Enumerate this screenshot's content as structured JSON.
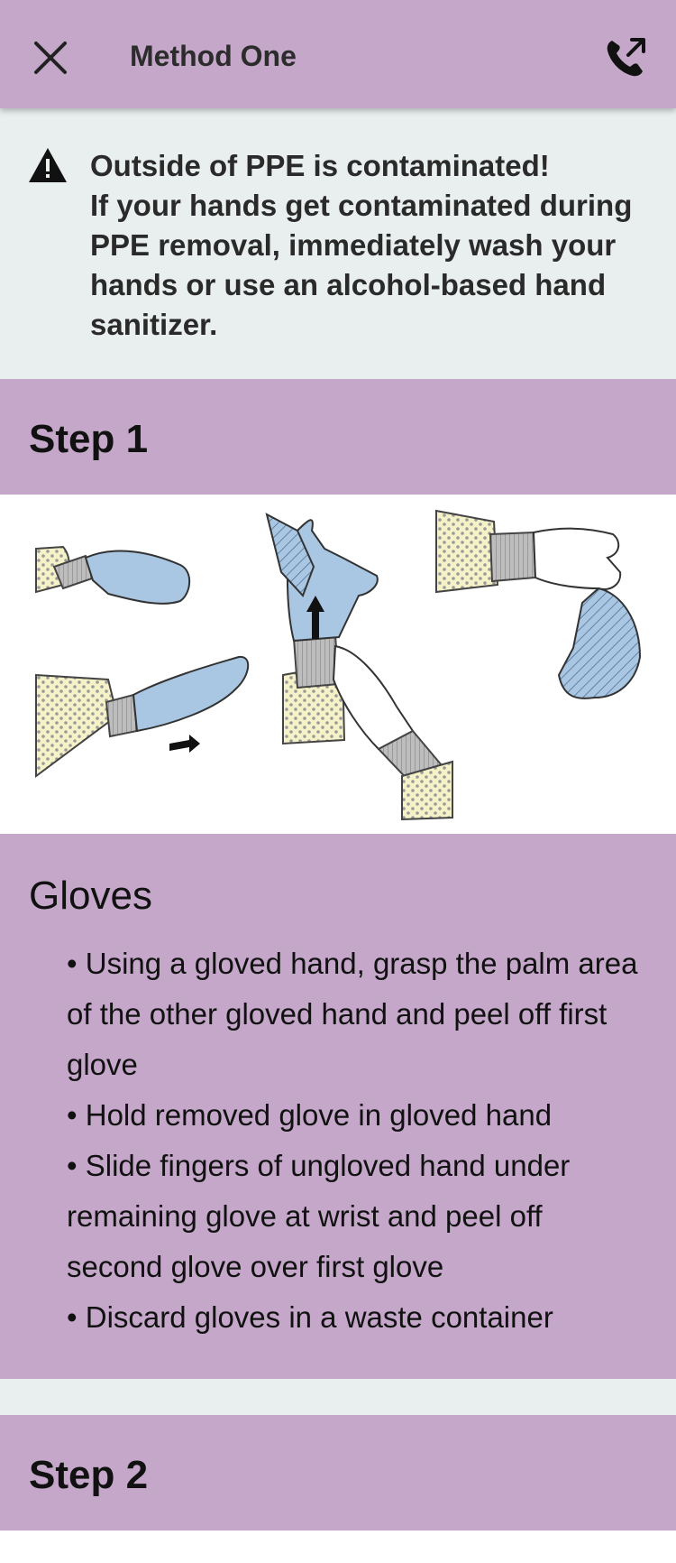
{
  "header": {
    "title": "Method One",
    "close_icon": "close-icon",
    "call_icon": "phone-call-icon"
  },
  "warning": {
    "icon": "warning-triangle-icon",
    "title": "Outside of PPE is contaminated!",
    "body": "If your hands get contaminated during PPE removal, immediately wash your hands or use an alcohol-based hand sanitizer."
  },
  "steps": [
    {
      "label": "Step 1",
      "section_title": "Gloves",
      "bullets": [
        "Using a gloved hand, grasp the palm area of the other gloved hand and peel off first glove",
        "Hold removed glove in gloved hand",
        "Slide fingers of ungloved hand under remaining glove at wrist and peel off second glove over first glove",
        "Discard gloves in a waste container"
      ]
    },
    {
      "label": "Step 2"
    }
  ],
  "colors": {
    "accent": "#c4a7c9",
    "warning_bg": "#e9efee",
    "glove_blue": "#a9c6e3",
    "sleeve_yellow": "#f6f2c8"
  }
}
